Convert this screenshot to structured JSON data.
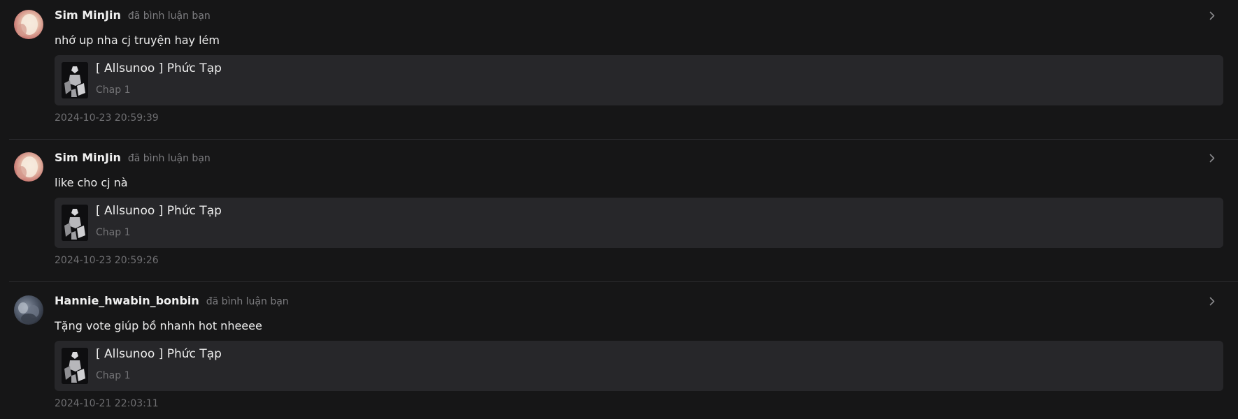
{
  "notifications": [
    {
      "user": "Sim MinJin",
      "action": "đã bình luận bạn",
      "comment": "nhớ up nha cj truyện hay lém",
      "story_title": "[ Allsunoo ] Phức Tạp",
      "chapter": "Chap 1",
      "timestamp": "2024-10-23 20:59:39",
      "avatar_icon": "user-avatar-icon",
      "thumbnail_icon": "story-cover-icon"
    },
    {
      "user": "Sim MinJin",
      "action": "đã bình luận bạn",
      "comment": "like cho cj nà",
      "story_title": "[ Allsunoo ] Phức Tạp",
      "chapter": "Chap 1",
      "timestamp": "2024-10-23 20:59:26",
      "avatar_icon": "user-avatar-icon",
      "thumbnail_icon": "story-cover-icon"
    },
    {
      "user": "Hannie_hwabin_bonbin",
      "action": "đã bình luận bạn",
      "comment": "Tặng vote giúp bồ nhanh hot nheeee",
      "story_title": "[ Allsunoo ] Phức Tạp",
      "chapter": "Chap 1",
      "timestamp": "2024-10-21 22:03:11",
      "avatar_icon": "user-avatar-icon",
      "thumbnail_icon": "story-cover-icon"
    }
  ],
  "colors": {
    "background": "#161617",
    "card": "#27272a",
    "text_primary": "#ececec",
    "text_muted": "#737376",
    "divider": "#2c2c2f"
  },
  "icons": {
    "chevron": "chevron-right-icon"
  }
}
